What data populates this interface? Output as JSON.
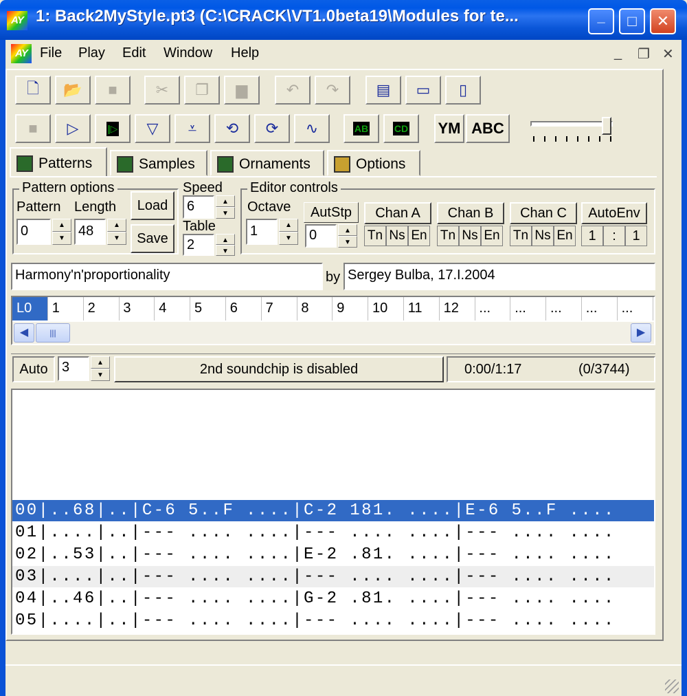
{
  "window": {
    "title": "1: Back2MyStyle.pt3 (C:\\CRACK\\VT1.0beta19\\Modules for te...",
    "logo": "AY",
    "controls": {
      "minimize": "_",
      "maximize": "□",
      "close": "✕"
    }
  },
  "menu": {
    "logo": "AY",
    "items": [
      "File",
      "Play",
      "Edit",
      "Window",
      "Help"
    ],
    "mdi": {
      "minimize": "_",
      "restore": "❐",
      "close": "✕"
    }
  },
  "toolbar": {
    "row1": [
      {
        "name": "new-icon",
        "glyph": "🗋",
        "disabled": false
      },
      {
        "name": "open-icon",
        "glyph": "📂",
        "disabled": false
      },
      {
        "name": "save-icon",
        "glyph": "■",
        "disabled": true
      },
      {
        "name": "cut-icon",
        "glyph": "✂",
        "disabled": true
      },
      {
        "name": "copy-icon",
        "glyph": "❐",
        "disabled": true
      },
      {
        "name": "paste-icon",
        "glyph": "▆",
        "disabled": true
      },
      {
        "name": "undo-icon",
        "glyph": "↶",
        "disabled": true
      },
      {
        "name": "redo-icon",
        "glyph": "↷",
        "disabled": true
      },
      {
        "name": "cascade-icon",
        "glyph": "▤",
        "disabled": false
      },
      {
        "name": "tile-horizontal-icon",
        "glyph": "▭",
        "disabled": false
      },
      {
        "name": "tile-vertical-icon",
        "glyph": "▯",
        "disabled": false
      }
    ],
    "row2": [
      {
        "name": "stop-icon",
        "glyph": "■",
        "disabled": true
      },
      {
        "name": "play-icon",
        "glyph": "▷",
        "disabled": false
      },
      {
        "name": "play-from-pos-icon",
        "glyph": "|▷",
        "disabled": false
      },
      {
        "name": "play-pattern-icon",
        "glyph": "▽",
        "disabled": false
      },
      {
        "name": "play-pattern-from-line-icon",
        "glyph": "⩡",
        "disabled": false
      },
      {
        "name": "loop-icon",
        "glyph": "⟲",
        "disabled": false
      },
      {
        "name": "loop-all-icon",
        "glyph": "⟳",
        "disabled": false
      },
      {
        "name": "sample-wave-icon",
        "glyph": "∿",
        "disabled": false
      },
      {
        "name": "toggle-chip-ab-icon",
        "glyph": "AB",
        "disabled": false
      },
      {
        "name": "toggle-chip-cd-icon",
        "glyph": "CD",
        "disabled": false
      }
    ],
    "ym_label": "YM",
    "abc_label": "ABC"
  },
  "tabs": [
    "Patterns",
    "Samples",
    "Ornaments",
    "Options"
  ],
  "pattern_options": {
    "label": "Pattern options",
    "pattern_label": "Pattern",
    "length_label": "Length",
    "pattern_value": "0",
    "length_value": "48",
    "load_label": "Load",
    "save_label": "Save"
  },
  "speed": {
    "label": "Speed",
    "value": "6"
  },
  "table": {
    "label": "Table",
    "value": "2"
  },
  "editor_controls": {
    "label": "Editor controls",
    "octave_label": "Octave",
    "octave_value": "1",
    "autstp_label": "AutStp",
    "autstp_value": "0",
    "channels": [
      {
        "label": "Chan A",
        "tn": "Tn",
        "ns": "Ns",
        "en": "En"
      },
      {
        "label": "Chan B",
        "tn": "Tn",
        "ns": "Ns",
        "en": "En"
      },
      {
        "label": "Chan C",
        "tn": "Tn",
        "ns": "Ns",
        "en": "En"
      }
    ],
    "autoenv_label": "AutoEnv",
    "autoenv_a": "1",
    "autoenv_sep": ":",
    "autoenv_b": "1"
  },
  "song": {
    "title": "Harmony'n'proportionality",
    "by_label": "by",
    "author": "Sergey Bulba, 17.I.2004"
  },
  "positions": [
    "L0",
    "1",
    "2",
    "3",
    "4",
    "5",
    "6",
    "7",
    "8",
    "9",
    "10",
    "11",
    "12",
    "...",
    "...",
    "...",
    "...",
    "..."
  ],
  "status": {
    "auto_label": "Auto",
    "auto_value": "3",
    "chip_message": "2nd soundchip is disabled",
    "time": "0:00/1:17",
    "ticks": "(0/3744)"
  },
  "pattern_rows": [
    "00|..68|..|C-6 5..F ....|C-2 181. ....|E-6 5..F ....",
    "01|....|..|--- .... ....|--- .... ....|--- .... ....",
    "02|..53|..|--- .... ....|E-2 .81. ....|--- .... ....",
    "03|....|..|--- .... ....|--- .... ....|--- .... ....",
    "04|..46|..|--- .... ....|G-2 .81. ....|--- .... ....",
    "05|....|..|--- .... ....|--- .... ....|--- .... ...."
  ]
}
